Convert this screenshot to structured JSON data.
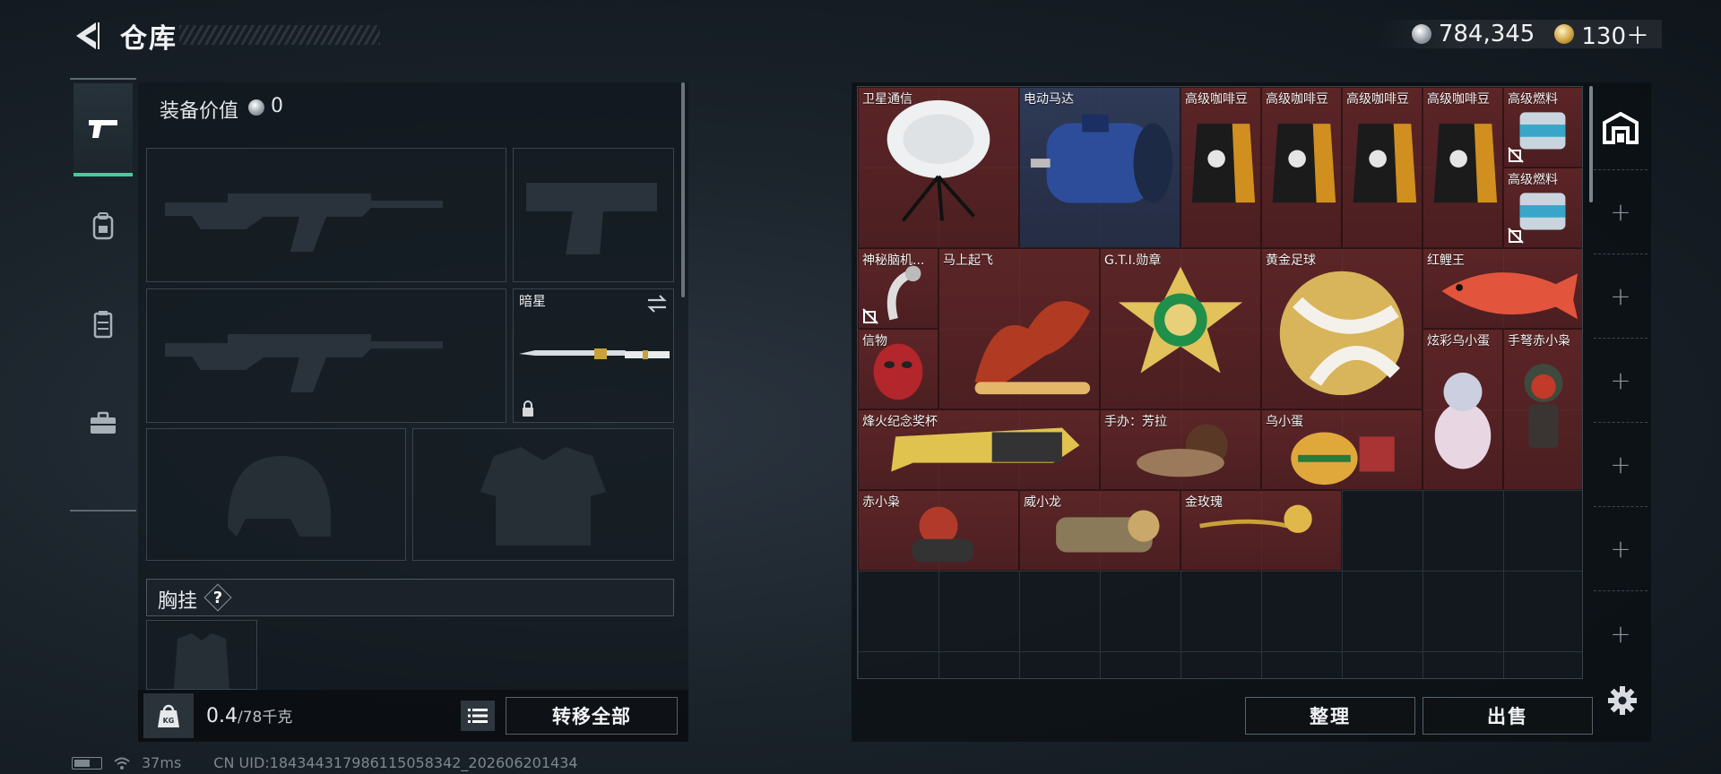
{
  "header": {
    "title": "仓库",
    "currency_silver": "784,345",
    "currency_gold": "130＋"
  },
  "left_tabs": [
    "firearms",
    "backpack",
    "vest",
    "toolbox"
  ],
  "loadout": {
    "equip_value_label": "装备价值",
    "equip_value": "0",
    "melee_name": "暗星",
    "chest_rig_label": "胸挂",
    "help_mark": "?"
  },
  "bottom": {
    "weight_current": "0.4",
    "weight_max": "/78千克",
    "transfer_all": "转移全部"
  },
  "status": {
    "ping": "37ms",
    "uid": "CN UID:184344317986115058342_202606201434"
  },
  "stash": {
    "items": [
      {
        "name": "卫星通信",
        "art": "dish"
      },
      {
        "name": "电动马达",
        "art": "motor"
      },
      {
        "name": "高级咖啡豆",
        "art": "coffee"
      },
      {
        "name": "高级咖啡豆",
        "art": "coffee"
      },
      {
        "name": "高级咖啡豆",
        "art": "coffee"
      },
      {
        "name": "高级咖啡豆",
        "art": "coffee"
      },
      {
        "name": "高级燃料",
        "art": "fuel"
      },
      {
        "name": "高级燃料",
        "art": "fuel"
      },
      {
        "name": "神秘脑机...",
        "art": "brain"
      },
      {
        "name": "马上起飞",
        "art": "horse"
      },
      {
        "name": "G.T.I.勋章",
        "art": "medal"
      },
      {
        "name": "黄金足球",
        "art": "ball"
      },
      {
        "name": "红鲤王",
        "art": "carp"
      },
      {
        "name": "信物",
        "art": "mask"
      },
      {
        "name": "炫彩乌小蛋",
        "art": "egg"
      },
      {
        "name": "手弩赤小枭",
        "art": "owlfig"
      },
      {
        "name": "烽火纪念奖杯",
        "art": "trophy"
      },
      {
        "name": "手办：芳拉",
        "art": "figure"
      },
      {
        "name": "乌小蛋",
        "art": "egg2"
      },
      {
        "name": "赤小枭",
        "art": "owl"
      },
      {
        "name": "威小龙",
        "art": "dragon"
      },
      {
        "name": "金玫瑰",
        "art": "rose"
      }
    ],
    "sort": "整理",
    "sell": "出售"
  },
  "colors": {
    "accent_green": "#3fcf9c",
    "item_red": "#782a2a",
    "item_blue": "#364264"
  }
}
